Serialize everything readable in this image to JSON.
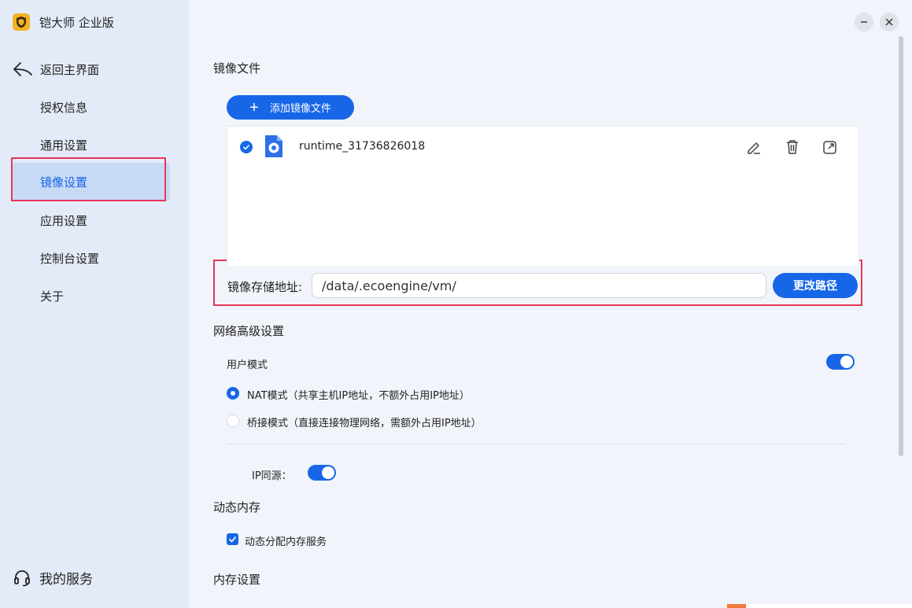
{
  "app": {
    "title": "铠大师 企业版"
  },
  "sidebar": {
    "back_label": "返回主界面",
    "items": [
      {
        "label": "授权信息"
      },
      {
        "label": "通用设置"
      },
      {
        "label": "镜像设置",
        "active": true
      },
      {
        "label": "应用设置"
      },
      {
        "label": "控制台设置"
      },
      {
        "label": "关于"
      }
    ],
    "service_label": "我的服务"
  },
  "image_files": {
    "section_title": "镜像文件",
    "add_button": "添加镜像文件",
    "files": [
      {
        "name": "runtime_31736826018",
        "checked": true
      }
    ],
    "path_label": "镜像存储地址:",
    "path_value": "/data/.ecoengine/vm/",
    "change_path_button": "更改路径"
  },
  "network": {
    "section_title": "网络高级设置",
    "user_mode_label": "用户模式",
    "user_mode_enabled": true,
    "options": [
      {
        "label": "NAT模式（共享主机IP地址，不额外占用IP地址）",
        "selected": true
      },
      {
        "label": "桥接模式（直接连接物理网络，需额外占用IP地址）",
        "selected": false
      }
    ],
    "ip_same_source_label": "IP同源：",
    "ip_same_source_enabled": true
  },
  "memory": {
    "section_title": "动态内存",
    "dynamic_alloc_label": "动态分配内存服务",
    "dynamic_alloc_checked": true
  },
  "memory_settings": {
    "section_title": "内存设置"
  },
  "colors": {
    "accent": "#1766e8",
    "sidebar_bg": "#e4ebf8",
    "highlight": "#e8355a",
    "logo": "#f3b21f"
  }
}
